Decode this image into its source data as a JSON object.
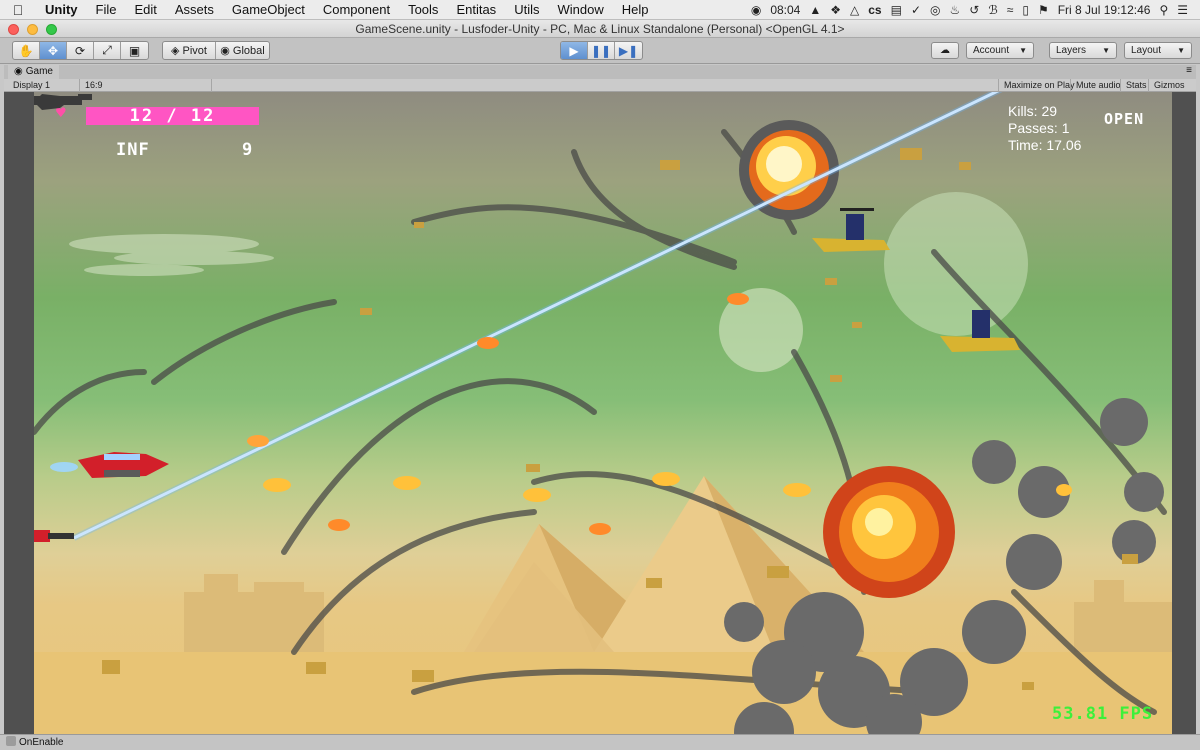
{
  "menubar": {
    "app_name": "Unity",
    "menus": [
      "File",
      "Edit",
      "Assets",
      "GameObject",
      "Component",
      "Tools",
      "Entitas",
      "Utils",
      "Window",
      "Help"
    ],
    "clock_small": "08:04",
    "date_time": "Fri 8 Jul  19:12:46",
    "status_icons": [
      "record-icon",
      "adobe-icon",
      "dropbox-icon",
      "drive-icon",
      "cs-icon",
      "clipboard-icon",
      "check-circle-icon",
      "vpn-icon",
      "volume-icon",
      "time-machine-icon",
      "bluetooth-icon",
      "wifi-icon",
      "battery-icon",
      "flag-icon",
      "search-icon",
      "list-icon"
    ]
  },
  "window": {
    "title": "GameScene.unity - Lusfoder-Unity - PC, Mac & Linux Standalone (Personal) <OpenGL 4.1>"
  },
  "toolbar": {
    "tools": [
      "hand-tool-icon",
      "move-tool-icon",
      "rotate-tool-icon",
      "scale-tool-icon",
      "rect-tool-icon"
    ],
    "pivot_label": "Pivot",
    "global_label": "Global",
    "play_icons": [
      "play-icon",
      "pause-icon",
      "step-icon"
    ],
    "account_label": "Account",
    "layers_label": "Layers",
    "layout_label": "Layout"
  },
  "game_tab": {
    "tab_label": "Game",
    "display_label": "Display 1",
    "aspect_label": "16:9",
    "maximize_label": "Maximize on Play",
    "mute_label": "Mute audio",
    "stats_label": "Stats",
    "gizmos_label": "Gizmos"
  },
  "hud": {
    "health": "12 / 12",
    "ammo": "INF",
    "rockets": "9",
    "kills": "Kills: 29",
    "passes": "Passes: 1",
    "time": "Time: 17.06",
    "status": "OPEN",
    "fps": "53.81 FPS",
    "heart_color": "#ff4fa8",
    "health_bar_color": "#ff55c3",
    "health_fraction": 1.0
  },
  "statusbar": {
    "message": "OnEnable"
  }
}
